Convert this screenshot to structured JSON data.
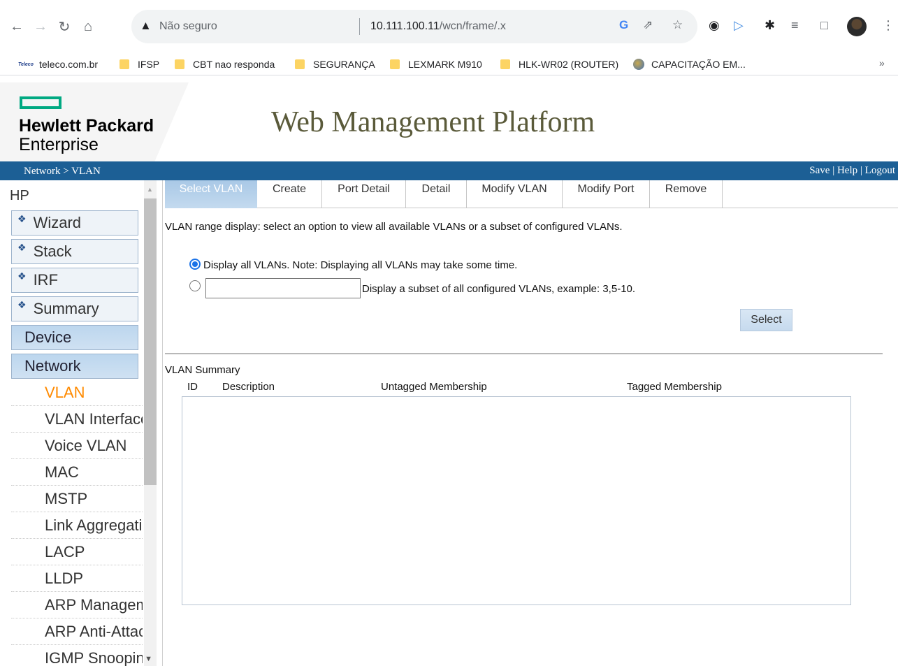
{
  "browser": {
    "security_label": "Não seguro",
    "url_host": "10.111.100.11",
    "url_path": "/wcn/frame/.x",
    "bookmarks": [
      {
        "label": "teleco.com.br",
        "icon": "teleco-icon"
      },
      {
        "label": "IFSP",
        "icon": "folder-icon"
      },
      {
        "label": "CBT nao responda",
        "icon": "folder-icon"
      },
      {
        "label": "SEGURANÇA",
        "icon": "folder-icon"
      },
      {
        "label": "LEXMARK M910",
        "icon": "folder-icon"
      },
      {
        "label": "HLK-WR02 (ROUTER)",
        "icon": "folder-icon"
      },
      {
        "label": "CAPACITAÇÃO EM...",
        "icon": "globe-icon"
      }
    ],
    "bookmarks_more": "»",
    "teleco_favicon_text": "Teleco"
  },
  "header": {
    "brand_line1": "Hewlett Packard",
    "brand_line2": "Enterprise",
    "title": "Web Management Platform",
    "breadcrumb": "Network > VLAN",
    "nav": {
      "save": "Save",
      "help": "Help",
      "logout": "Logout",
      "sep": " | "
    }
  },
  "sidebar": {
    "root": "HP",
    "main_items": [
      "Wizard",
      "Stack",
      "IRF",
      "Summary"
    ],
    "sections": [
      "Device",
      "Network"
    ],
    "network_items": [
      "VLAN",
      "VLAN Interface",
      "Voice VLAN",
      "MAC",
      "MSTP",
      "Link Aggregatio",
      "LACP",
      "LLDP",
      "ARP Manageme",
      "ARP Anti-Attack",
      "IGMP Snooping"
    ],
    "active_item": "VLAN"
  },
  "tabs": [
    "Select VLAN",
    "Create",
    "Port Detail",
    "Detail",
    "Modify VLAN",
    "Modify Port",
    "Remove"
  ],
  "active_tab": "Select VLAN",
  "content": {
    "range_desc": "VLAN range display: select an option to view all available VLANs or a subset of configured VLANs.",
    "option_all": "Display all VLANs. Note: Displaying all VLANs may take some time.",
    "option_subset": "Display a subset of all configured VLANs, example: 3,5-10.",
    "subset_value": "",
    "select_button": "Select",
    "summary_title": "VLAN Summary",
    "columns": [
      "ID",
      "Description",
      "Untagged Membership",
      "Tagged Membership"
    ],
    "rows": []
  },
  "colors": {
    "brand_green": "#01a982",
    "header_blue": "#1c5f95",
    "active_item": "#ff8a00",
    "tab_active": "#a9c8e6"
  }
}
